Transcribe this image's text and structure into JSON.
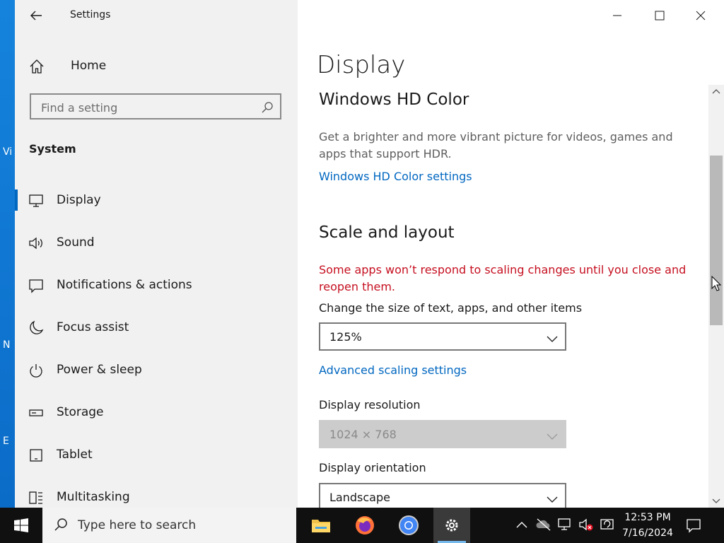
{
  "window": {
    "app_title": "Settings"
  },
  "nav": {
    "home_label": "Home",
    "search_placeholder": "Find a setting",
    "section_title": "System",
    "items": [
      {
        "label": "Display",
        "icon": "monitor-icon",
        "selected": true
      },
      {
        "label": "Sound",
        "icon": "speaker-icon"
      },
      {
        "label": "Notifications & actions",
        "icon": "notification-icon"
      },
      {
        "label": "Focus assist",
        "icon": "moon-icon"
      },
      {
        "label": "Power & sleep",
        "icon": "power-icon"
      },
      {
        "label": "Storage",
        "icon": "storage-icon"
      },
      {
        "label": "Tablet",
        "icon": "tablet-icon"
      },
      {
        "label": "Multitasking",
        "icon": "multitasking-icon"
      }
    ]
  },
  "content": {
    "page_title": "Display",
    "hdr": {
      "heading": "Windows HD Color",
      "description": "Get a brighter and more vibrant picture for videos, games and apps that support HDR.",
      "link": "Windows HD Color settings"
    },
    "scale": {
      "heading": "Scale and layout",
      "warning": "Some apps won’t respond to scaling changes until you close and reopen them.",
      "size_label": "Change the size of text, apps, and other items",
      "size_value": "125%",
      "advanced_link": "Advanced scaling settings",
      "resolution_label": "Display resolution",
      "resolution_value": "1024 × 768",
      "orientation_label": "Display orientation",
      "orientation_value": "Landscape"
    }
  },
  "taskbar": {
    "search_text": "Type here to search",
    "time": "12:53 PM",
    "date": "7/16/2024",
    "apps": [
      "file-explorer-icon",
      "firefox-icon",
      "chrome-icon",
      "settings-icon"
    ]
  },
  "desktop": {
    "edge_chars": [
      "Vi",
      "N",
      "E"
    ]
  },
  "colors": {
    "accent": "#0067c0",
    "warning": "#c50f1f",
    "nav_bg": "#f1f1f1",
    "taskbar_bg": "#101010"
  }
}
